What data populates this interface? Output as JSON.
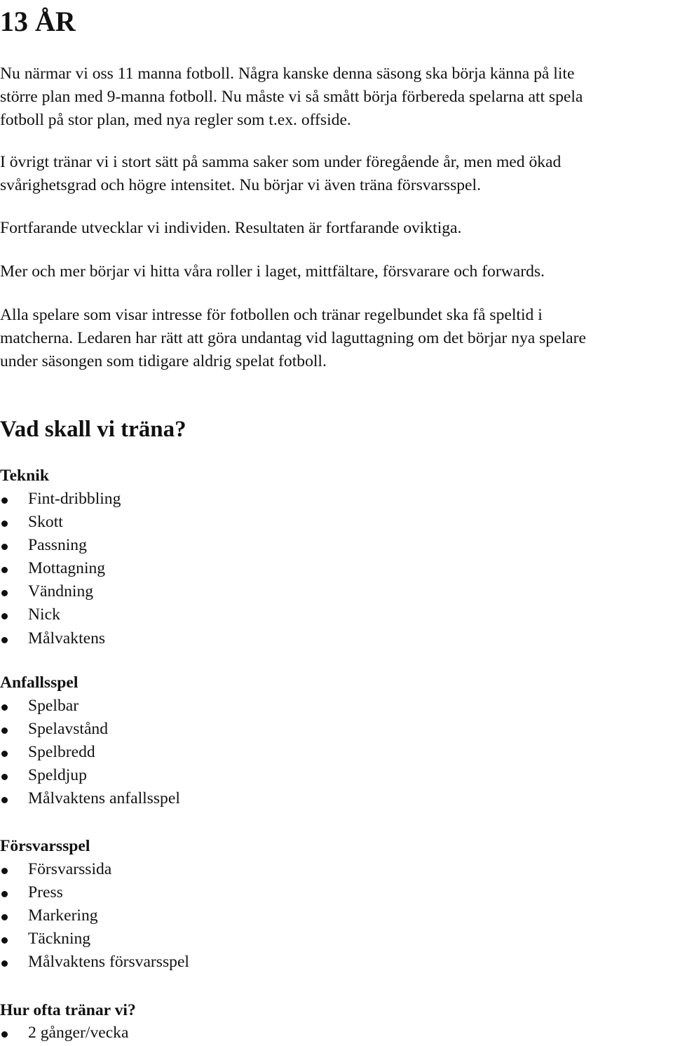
{
  "document": {
    "title": "13 ÅR",
    "intro_paragraphs": [
      {
        "lines": [
          "Nu närmar vi oss 11 manna fotboll. Några kanske denna säsong ska börja känna på lite",
          "större plan med 9-manna fotboll. Nu måste vi så smått börja förbereda spelarna att spela",
          "fotboll på stor plan, med nya regler som t.ex. offside."
        ]
      },
      {
        "lines": [
          "I övrigt tränar vi i stort sätt på samma saker som under föregående år, men med ökad",
          "svårighetsgrad och högre intensitet. Nu börjar vi även träna försvarsspel."
        ]
      },
      {
        "lines": [
          "Fortfarande utvecklar vi individen. Resultaten är fortfarande oviktiga."
        ]
      },
      {
        "lines": [
          "Mer och mer börjar vi hitta våra roller i laget, mittfältare, försvarare och forwards."
        ]
      },
      {
        "lines": [
          "Alla spelare som visar intresse för fotbollen och tränar regelbundet ska få speltid i",
          "matcherna. Ledaren har rätt att göra undantag vid laguttagning om det börjar nya spelare",
          "under säsongen som tidigare aldrig spelat fotboll."
        ]
      }
    ],
    "training_section": {
      "heading": "Vad skall vi träna?",
      "groups": [
        {
          "heading": "Teknik",
          "items": [
            "Fint-dribbling",
            "Skott",
            "Passning",
            "Mottagning",
            "Vändning",
            "Nick",
            "Målvaktens"
          ]
        },
        {
          "heading": "Anfallsspel",
          "items": [
            "Spelbar",
            "Spelavstånd",
            "Spelbredd",
            "Speldjup",
            "Målvaktens anfallsspel"
          ]
        },
        {
          "heading": "Försvarsspel",
          "items": [
            "Försvarssida",
            "Press",
            "Markering",
            "Täckning",
            "Målvaktens försvarsspel"
          ]
        },
        {
          "heading": "Hur ofta tränar vi?",
          "items": [
            "2 gånger/vecka"
          ]
        }
      ]
    }
  }
}
